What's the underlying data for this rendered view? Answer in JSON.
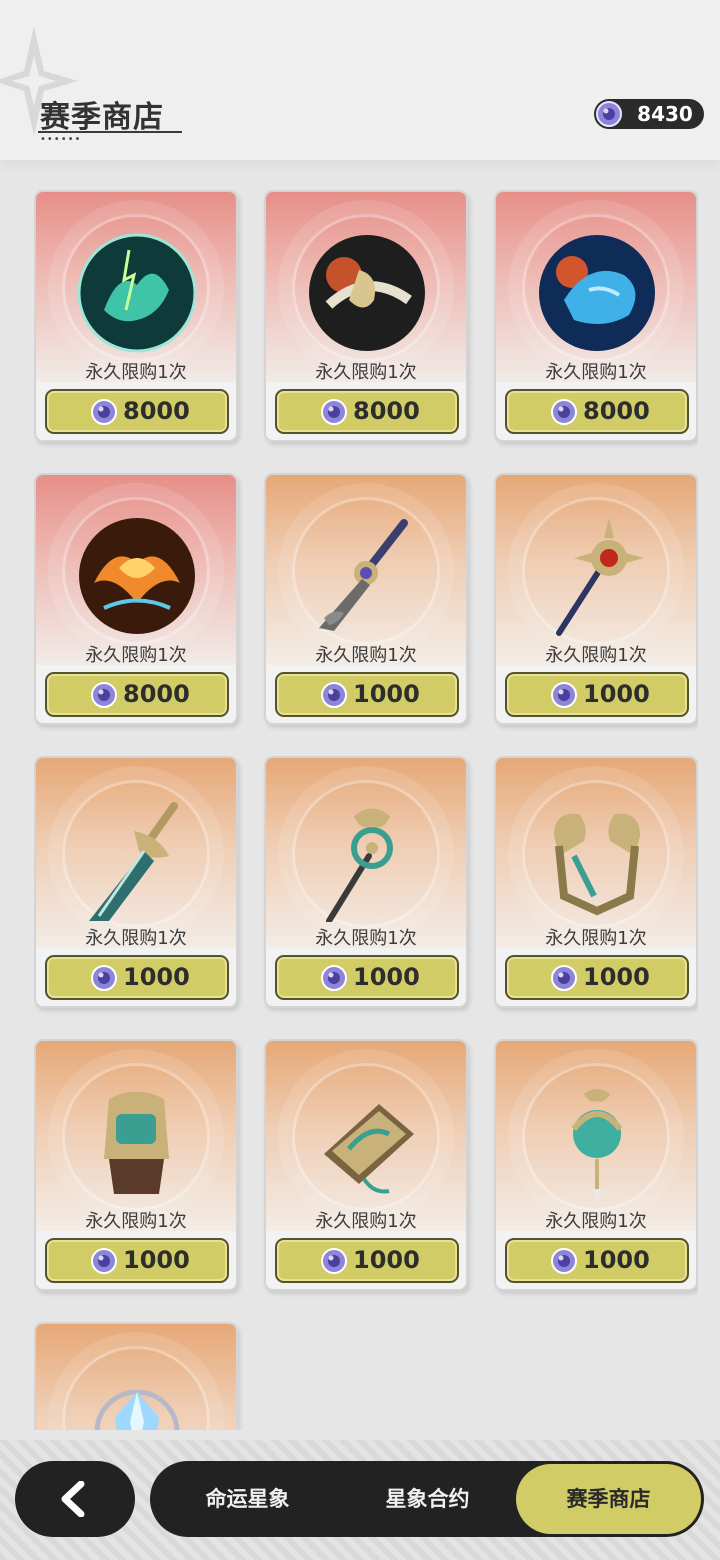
{
  "header": {
    "title": "赛季商店",
    "title_dots": "••••••",
    "currency_amount": "8430"
  },
  "shop": {
    "items": [
      {
        "limit": "永久限购1次",
        "price": "8000",
        "tier": "red",
        "icon": "lightning-dragon-icon"
      },
      {
        "limit": "永久限购1次",
        "price": "8000",
        "tier": "red",
        "icon": "black-tiger-icon"
      },
      {
        "limit": "永久限购1次",
        "price": "8000",
        "tier": "red",
        "icon": "blue-dragon-icon"
      },
      {
        "limit": "永久限购1次",
        "price": "8000",
        "tier": "red",
        "icon": "phoenix-icon"
      },
      {
        "limit": "永久限购1次",
        "price": "1000",
        "tier": "orange",
        "icon": "sword-icon"
      },
      {
        "limit": "永久限购1次",
        "price": "1000",
        "tier": "orange",
        "icon": "sun-staff-icon"
      },
      {
        "limit": "永久限购1次",
        "price": "1000",
        "tier": "orange",
        "icon": "greatsword-icon"
      },
      {
        "limit": "永久限购1次",
        "price": "1000",
        "tier": "orange",
        "icon": "wheel-polearm-icon"
      },
      {
        "limit": "永久限购1次",
        "price": "1000",
        "tier": "orange",
        "icon": "bow-icon"
      },
      {
        "limit": "永久限购1次",
        "price": "1000",
        "tier": "orange",
        "icon": "gauntlet-icon"
      },
      {
        "limit": "永久限购1次",
        "price": "1000",
        "tier": "orange",
        "icon": "catalyst-book-icon"
      },
      {
        "limit": "永久限购1次",
        "price": "1000",
        "tier": "orange",
        "icon": "orb-pendant-icon"
      },
      {
        "limit": "",
        "price": "",
        "tier": "orange",
        "icon": "crystal-icon"
      }
    ]
  },
  "bottom_nav": {
    "back_icon": "chevron-left-icon",
    "tabs": [
      {
        "label": "命运星象"
      },
      {
        "label": "星象合约"
      },
      {
        "label": "赛季商店"
      }
    ],
    "active_tab": "赛季商店"
  },
  "colors": {
    "price_button": "#d2cc66",
    "red_tier": "#e78f89",
    "orange_tier": "#e6a877",
    "dark_bar": "#222222"
  }
}
